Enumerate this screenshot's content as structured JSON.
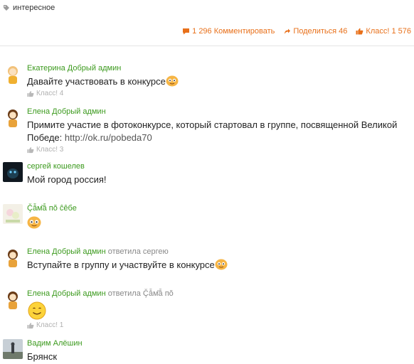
{
  "tag": {
    "label": "интересное",
    "icon": "tag-icon"
  },
  "actions": {
    "comment": {
      "icon": "comment-icon",
      "label": "1 296 Комментировать"
    },
    "share": {
      "icon": "share-icon",
      "label": "Поделиться 46"
    },
    "like": {
      "icon": "thumbs-up-icon",
      "label": "Класс! 1 576"
    }
  },
  "comments": [
    {
      "author": "Екатерина Добрый админ",
      "text": "Давайте участвовать в конкурсе",
      "like": "Класс! 4"
    },
    {
      "author": "Елена Добрый админ",
      "text": "Примите участие в фотоконкурсе, который стартовал в группе, посвященной Великой Победе: ",
      "link": "http://ok.ru/pobeda70",
      "like": "Класс! 3"
    },
    {
      "author": "сергей кошелев",
      "text": "Мой город россия!"
    },
    {
      "author": "Ç̆ẫм̆ẫ пŏ ĉêбе"
    },
    {
      "author": "Елена Добрый админ",
      "reply": "ответила",
      "reply_to": "сергею",
      "text": "Вступайте в группу и участвуйте в конкурсе"
    },
    {
      "author": "Елена Добрый админ",
      "reply": "ответила",
      "reply_to": "Ç̆ẫм̆ẫ пŏ",
      "like": "Класс! 1"
    },
    {
      "author": "Вадим Алёшин",
      "text": "Брянск"
    }
  ]
}
